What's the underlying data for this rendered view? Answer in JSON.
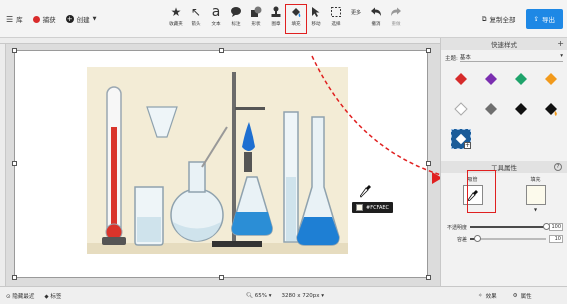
{
  "toolbar": {
    "menu_label": "库",
    "capture_label": "捕获",
    "create_label": "创建",
    "tools": [
      {
        "icon": "star-icon",
        "label": "收藏夹"
      },
      {
        "icon": "arrow-icon",
        "label": "箭头"
      },
      {
        "icon": "text-icon",
        "label": "文本"
      },
      {
        "icon": "callout-icon",
        "label": "标注"
      },
      {
        "icon": "shape-icon",
        "label": "形状"
      },
      {
        "icon": "stamp-icon",
        "label": "图章"
      },
      {
        "icon": "fill-icon",
        "label": "填充"
      },
      {
        "icon": "move-icon",
        "label": "移动"
      },
      {
        "icon": "select-icon",
        "label": "选择"
      },
      {
        "icon": "more-icon",
        "label": "更多"
      },
      {
        "icon": "undo-icon",
        "label": "撤消"
      },
      {
        "icon": "redo-icon",
        "label": "重做"
      }
    ],
    "text_glyph": "a",
    "more_glyph": "更多",
    "active_tool": "填充",
    "copy_all_label": "复制全部",
    "export_label": "导出"
  },
  "canvas": {
    "picked_color": "#FCFAEC"
  },
  "panel": {
    "quick_styles_title": "快速样式",
    "theme_label": "主题:",
    "theme_value": "基本",
    "swatch_colors": [
      "#d62b2b",
      "#7b2fb0",
      "#1fa36b",
      "#f29a1c",
      "#ffffff",
      "#6f6f6f",
      "#111111",
      "#111111"
    ],
    "tool_props_title": "工具属性",
    "help_label": "?",
    "dropper_label": "吸管",
    "fill_label": "填充",
    "fill_color": "#FCFAEC",
    "opacity_label": "不透明度",
    "opacity_value": "100",
    "opacity_level": 1.0,
    "tolerance_label": "容差",
    "tolerance_value": "10",
    "tolerance_level": 0.1
  },
  "statusbar": {
    "hide_recent_label": "隐藏最近",
    "tags_label": "标签",
    "zoom_label": "65%",
    "size_label": "3280 x 720px",
    "effects_label": "效果",
    "properties_label": "属性"
  }
}
